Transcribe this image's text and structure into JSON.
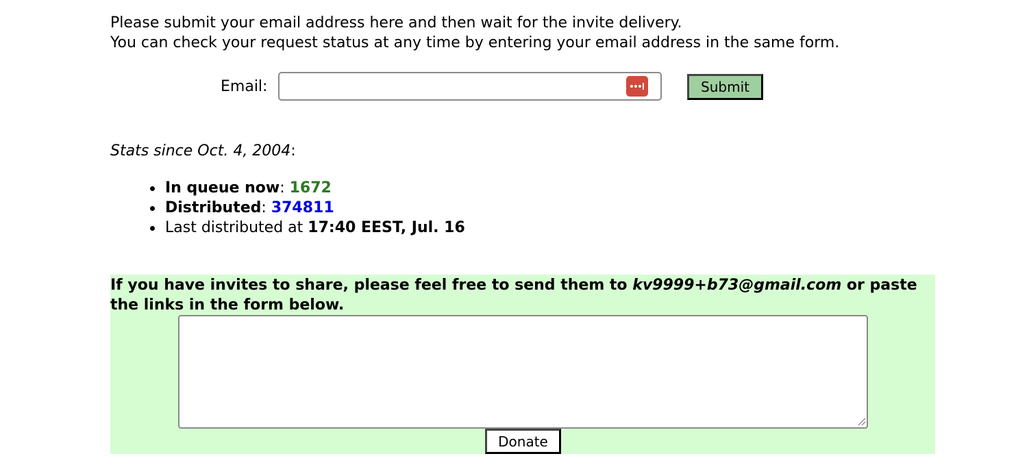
{
  "intro": {
    "line1": "Please submit your email address here and then wait for the invite delivery.",
    "line2": "You can check your request status at any time by entering your email address in the same form."
  },
  "email_form": {
    "label": "Email:",
    "value": "",
    "placeholder": "",
    "submit_label": "Submit",
    "password_manager_icon": "password-manager-icon",
    "submit_color": "#a0cf9f",
    "password_icon_color": "#d04a3e"
  },
  "stats": {
    "title": "Stats since Oct. 4, 2004",
    "title_suffix": ":",
    "in_queue_label": "In queue now",
    "in_queue_value": "1672",
    "distributed_label": "Distributed",
    "distributed_value": "374811",
    "last_distributed_prefix": "Last distributed at ",
    "last_distributed_value": "17:40 EEST, Jul. 16",
    "separator": ": ",
    "in_queue_color": "#2f7a22",
    "distributed_color": "#0000e0"
  },
  "share": {
    "text_prefix": "If you have invites to share, please feel free to send them to ",
    "email": "kv9999+b73@gmail.com",
    "text_suffix": " or paste the links in the form below.",
    "links_value": "",
    "donate_label": "Donate",
    "background": "#d6fdd2"
  }
}
